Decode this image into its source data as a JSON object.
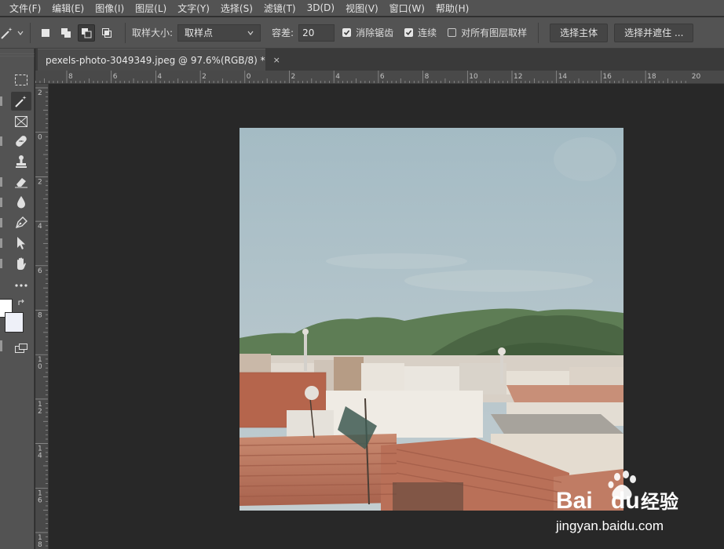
{
  "menu": [
    "文件(F)",
    "编辑(E)",
    "图像(I)",
    "图层(L)",
    "文字(Y)",
    "选择(S)",
    "滤镜(T)",
    "3D(D)",
    "视图(V)",
    "窗口(W)",
    "帮助(H)"
  ],
  "options": {
    "sample_size_label": "取样大小:",
    "sample_size_value": "取样点",
    "tolerance_label": "容差:",
    "tolerance_value": "20",
    "antialias_label": "消除锯齿",
    "antialias_checked": true,
    "contiguous_label": "连续",
    "contiguous_checked": true,
    "sample_all_layers_label": "对所有图层取样",
    "sample_all_layers_checked": false,
    "select_subject_button": "选择主体",
    "select_and_mask_button": "选择并遮住 ..."
  },
  "document_tab": {
    "title": "pexels-photo-3049349.jpeg @ 97.6%(RGB/8) *",
    "close_glyph": "×"
  },
  "ruler": {
    "horizontal_labels": [
      "8",
      "6",
      "4",
      "2",
      "0",
      "2",
      "4",
      "6",
      "8",
      "10",
      "12",
      "14",
      "16",
      "18",
      "20"
    ],
    "vertical_labels": [
      "2",
      "0",
      "2",
      "4",
      "6",
      "8",
      "10",
      "12",
      "14",
      "16",
      "18"
    ]
  },
  "tools": [
    "marquee-tool",
    "magic-wand-tool",
    "frame-tool",
    "healing-brush-tool",
    "clone-stamp-tool",
    "eraser-tool",
    "blur-tool",
    "pen-tool",
    "path-selection-tool",
    "hand-tool",
    "more-tools",
    "color-swatches",
    "screen-mode"
  ],
  "watermark": {
    "logo_text": "Bai",
    "logo_text_2": "du",
    "product": "经验",
    "url": "jingyan.baidu.com"
  },
  "colors": {
    "chrome": "#535353",
    "dark": "#282828",
    "sky": "#a9bfc6",
    "hills": "#5d7a52",
    "roof": "#bf7a62"
  }
}
